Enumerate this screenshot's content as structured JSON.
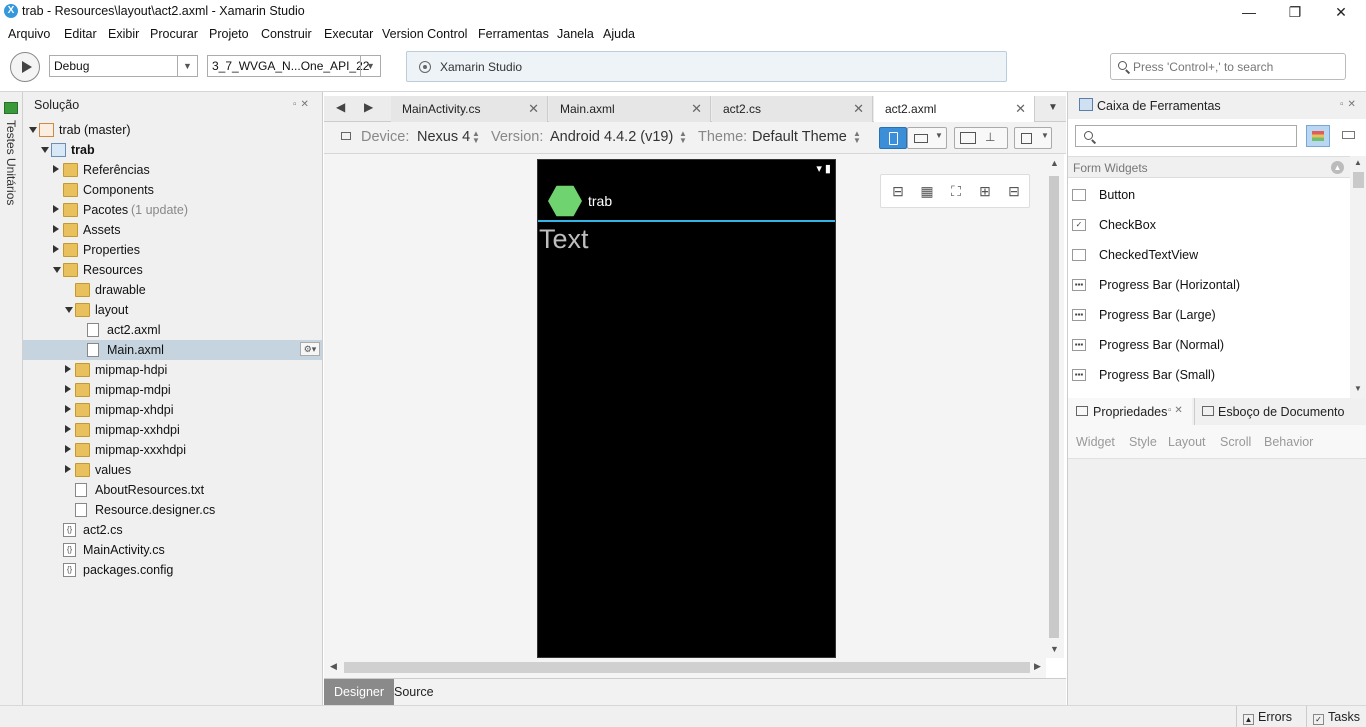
{
  "window": {
    "title": "trab - Resources\\layout\\act2.axml - Xamarin Studio",
    "minimize": "—",
    "maximize": "❐",
    "close": "✕"
  },
  "menu": [
    "Arquivo",
    "Editar",
    "Exibir",
    "Procurar",
    "Projeto",
    "Construir",
    "Executar",
    "Version Control",
    "Ferramentas",
    "Janela",
    "Ajuda"
  ],
  "toolbar": {
    "config": "Debug",
    "device": "3_7_WVGA_N...One_API_22",
    "status": "Xamarin Studio",
    "search_placeholder": "Press 'Control+,' to search"
  },
  "left_strip": {
    "label": "Testes Unitários"
  },
  "solution": {
    "title": "Solução",
    "items": [
      {
        "label": "trab (master)",
        "extra": "",
        "depth": 0,
        "arrow": "open",
        "icon": "solution"
      },
      {
        "label": "trab",
        "extra": "",
        "depth": 1,
        "arrow": "open",
        "icon": "project"
      },
      {
        "label": "Referências",
        "extra": "",
        "depth": 2,
        "arrow": "closed",
        "icon": "folder"
      },
      {
        "label": "Components",
        "extra": "",
        "depth": 2,
        "arrow": "none",
        "icon": "folder"
      },
      {
        "label": "Pacotes",
        "extra": "(1 update)",
        "depth": 2,
        "arrow": "closed",
        "icon": "folder"
      },
      {
        "label": "Assets",
        "extra": "",
        "depth": 2,
        "arrow": "closed",
        "icon": "folder"
      },
      {
        "label": "Properties",
        "extra": "",
        "depth": 2,
        "arrow": "closed",
        "icon": "folder"
      },
      {
        "label": "Resources",
        "extra": "",
        "depth": 2,
        "arrow": "open",
        "icon": "folder"
      },
      {
        "label": "drawable",
        "extra": "",
        "depth": 3,
        "arrow": "none",
        "icon": "folder"
      },
      {
        "label": "layout",
        "extra": "",
        "depth": 3,
        "arrow": "open",
        "icon": "folder"
      },
      {
        "label": "act2.axml",
        "extra": "",
        "depth": 4,
        "arrow": "none",
        "icon": "file"
      },
      {
        "label": "Main.axml",
        "extra": "",
        "depth": 4,
        "arrow": "none",
        "icon": "file",
        "selected": true
      },
      {
        "label": "mipmap-hdpi",
        "extra": "",
        "depth": 3,
        "arrow": "closed",
        "icon": "folder"
      },
      {
        "label": "mipmap-mdpi",
        "extra": "",
        "depth": 3,
        "arrow": "closed",
        "icon": "folder"
      },
      {
        "label": "mipmap-xhdpi",
        "extra": "",
        "depth": 3,
        "arrow": "closed",
        "icon": "folder"
      },
      {
        "label": "mipmap-xxhdpi",
        "extra": "",
        "depth": 3,
        "arrow": "closed",
        "icon": "folder"
      },
      {
        "label": "mipmap-xxxhdpi",
        "extra": "",
        "depth": 3,
        "arrow": "closed",
        "icon": "folder"
      },
      {
        "label": "values",
        "extra": "",
        "depth": 3,
        "arrow": "closed",
        "icon": "folder"
      },
      {
        "label": "AboutResources.txt",
        "extra": "",
        "depth": 3,
        "arrow": "none",
        "icon": "file"
      },
      {
        "label": "Resource.designer.cs",
        "extra": "",
        "depth": 3,
        "arrow": "none",
        "icon": "file"
      },
      {
        "label": "act2.cs",
        "extra": "",
        "depth": 2,
        "arrow": "none",
        "icon": "csfile"
      },
      {
        "label": "MainActivity.cs",
        "extra": "",
        "depth": 2,
        "arrow": "none",
        "icon": "csfile"
      },
      {
        "label": "packages.config",
        "extra": "",
        "depth": 2,
        "arrow": "none",
        "icon": "csfile"
      }
    ]
  },
  "editor": {
    "tabs": [
      {
        "label": "MainActivity.cs",
        "active": false
      },
      {
        "label": "Main.axml",
        "active": false
      },
      {
        "label": "act2.cs",
        "active": false
      },
      {
        "label": "act2.axml",
        "active": true
      }
    ],
    "device_label": "Device:",
    "device_value": "Nexus 4",
    "version_label": "Version:",
    "version_value": "Android 4.4.2 (v19)",
    "theme_label": "Theme:",
    "theme_value": "Default Theme",
    "phone": {
      "app_name": "trab",
      "textview": "Text"
    },
    "mode_tabs": [
      {
        "label": "Designer",
        "active": true
      },
      {
        "label": "Source",
        "active": false
      }
    ]
  },
  "toolbox": {
    "title": "Caixa de Ferramentas",
    "category": "Form Widgets",
    "widgets": [
      {
        "label": "Button",
        "icon": "button-icon"
      },
      {
        "label": "CheckBox",
        "icon": "checkbox-icon"
      },
      {
        "label": "CheckedTextView",
        "icon": "checkedtextview-icon"
      },
      {
        "label": "Progress Bar (Horizontal)",
        "icon": "progressbar-icon"
      },
      {
        "label": "Progress Bar (Large)",
        "icon": "progressbar-icon"
      },
      {
        "label": "Progress Bar (Normal)",
        "icon": "progressbar-icon"
      },
      {
        "label": "Progress Bar (Small)",
        "icon": "progressbar-icon"
      }
    ]
  },
  "properties": {
    "tab": "Propriedades",
    "outline_tab": "Esboço de Documento",
    "categories": [
      "Widget",
      "Style",
      "Layout",
      "Scroll",
      "Behavior"
    ]
  },
  "statusbar": {
    "errors": "Errors",
    "tasks": "Tasks"
  },
  "colors": {
    "accent": "#3b8fd9",
    "selection": "#c6d4e0",
    "android_holo": "#33b5e5",
    "app_icon": "#6fd46f"
  }
}
